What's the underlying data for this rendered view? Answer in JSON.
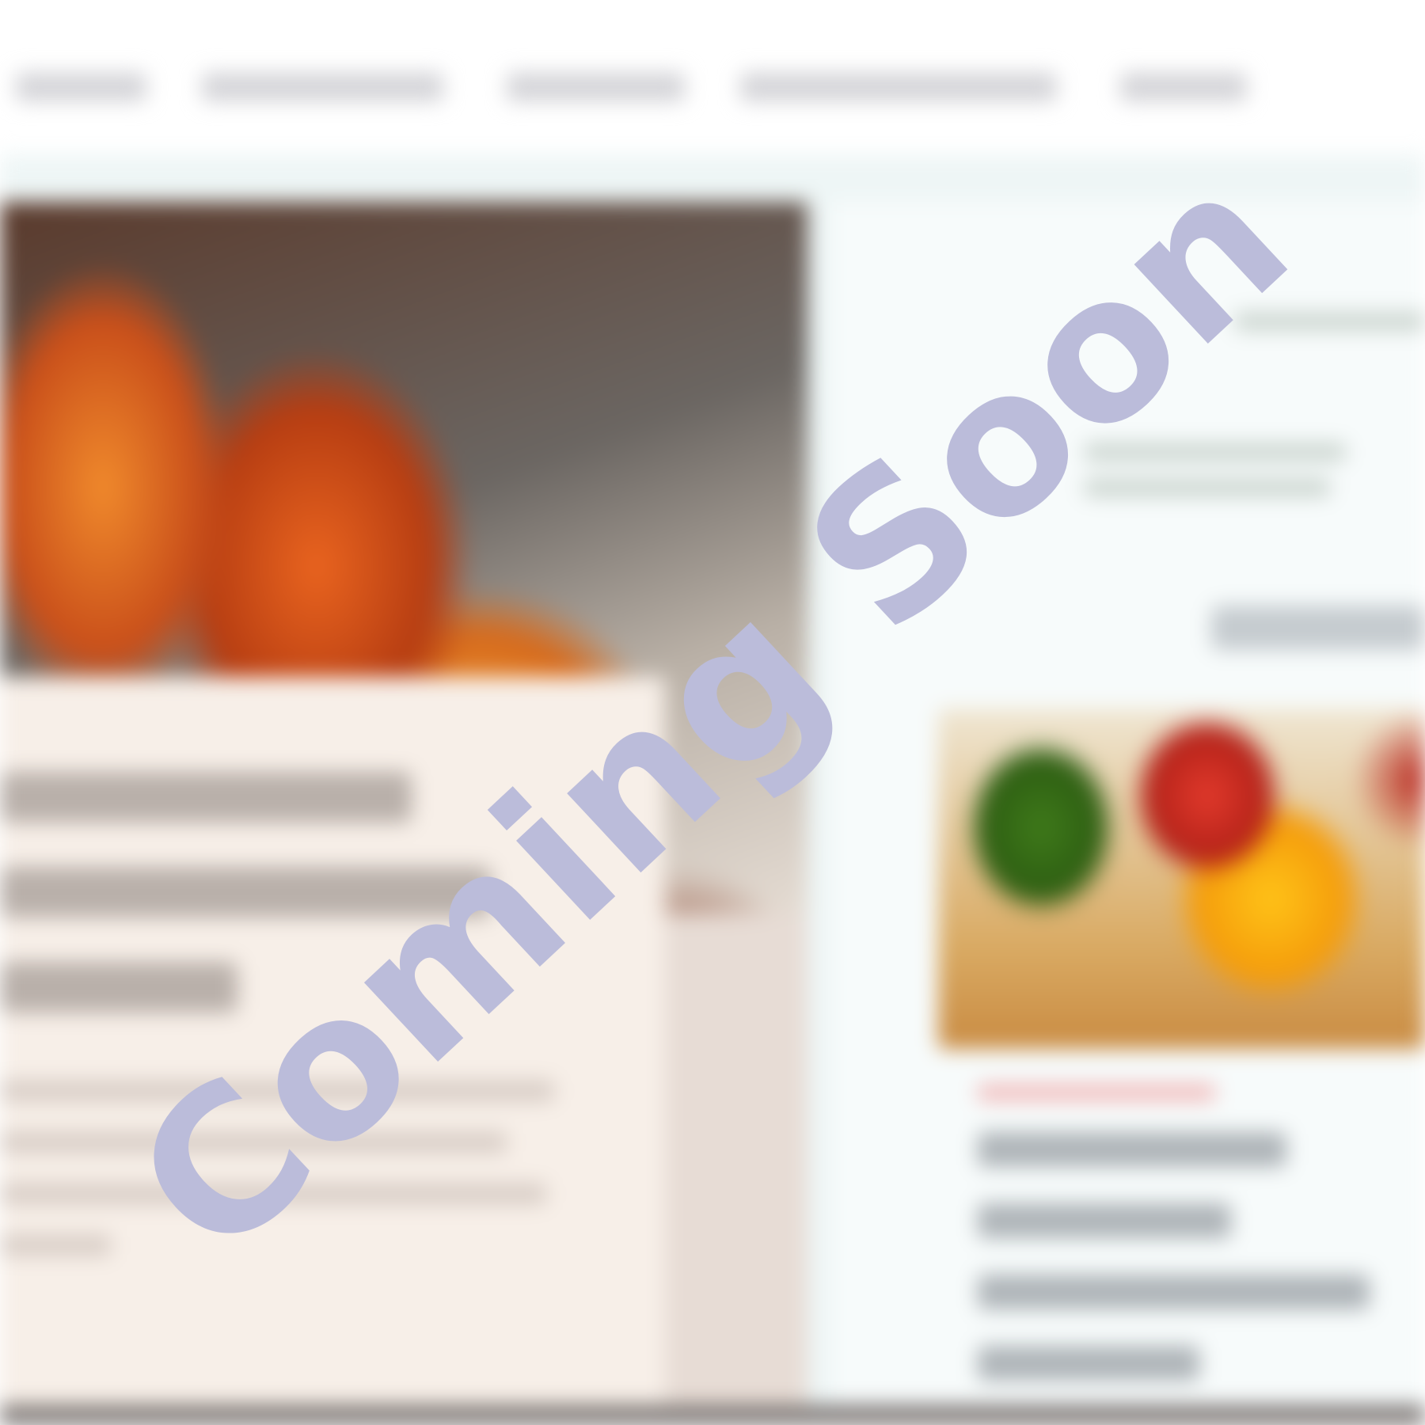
{
  "overlay": {
    "watermark_text": "Coming Soon",
    "watermark_color": "#bbbcda"
  },
  "background": {
    "state": "blurred-preview",
    "nav_item_count": 5,
    "colors": {
      "page_band": "#eef6f6",
      "hero_panel": "#f7efe8",
      "sidebar": "#f7fbfb",
      "bottom_bar": "#7a7472"
    }
  }
}
